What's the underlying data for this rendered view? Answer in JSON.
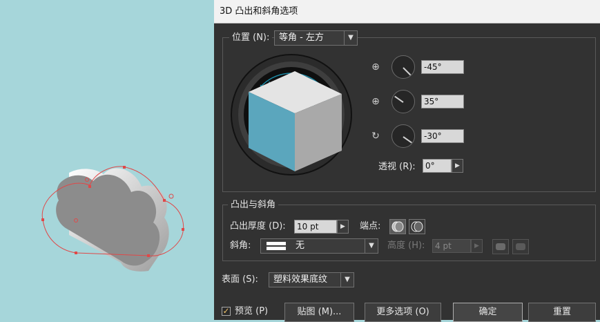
{
  "dialog": {
    "title": "3D 凸出和斜角选项"
  },
  "position": {
    "label": "位置 (N):",
    "preset": "等角 - 左方",
    "rotations": [
      {
        "icon": "x-axis-rotate-icon",
        "value": "-45°"
      },
      {
        "icon": "y-axis-rotate-icon",
        "value": "35°"
      },
      {
        "icon": "z-axis-rotate-icon",
        "value": "-30°"
      }
    ],
    "perspective_label": "透视 (R):",
    "perspective_value": "0°"
  },
  "extrude": {
    "group_label": "凸出与斜角",
    "depth_label": "凸出厚度 (D):",
    "depth_value": "10 pt",
    "cap_label": "端点:",
    "bevel_label": "斜角:",
    "bevel_value": "无",
    "height_label": "高度 (H):",
    "height_value": "4 pt"
  },
  "surface": {
    "label": "表面 (S):",
    "value": "塑料效果底纹"
  },
  "footer": {
    "preview_label": "预览 (P)",
    "preview_checked": true,
    "map_art_label": "贴图 (M)...",
    "more_options_label": "更多选项 (O)",
    "ok_label": "确定",
    "reset_label": "重置"
  },
  "colors": {
    "canvas": "#a6d6da",
    "cube_left": "#5ba6bd",
    "cube_top": "#e4e4e4",
    "cube_right": "#a9a9a9",
    "selection": "#e04848"
  }
}
